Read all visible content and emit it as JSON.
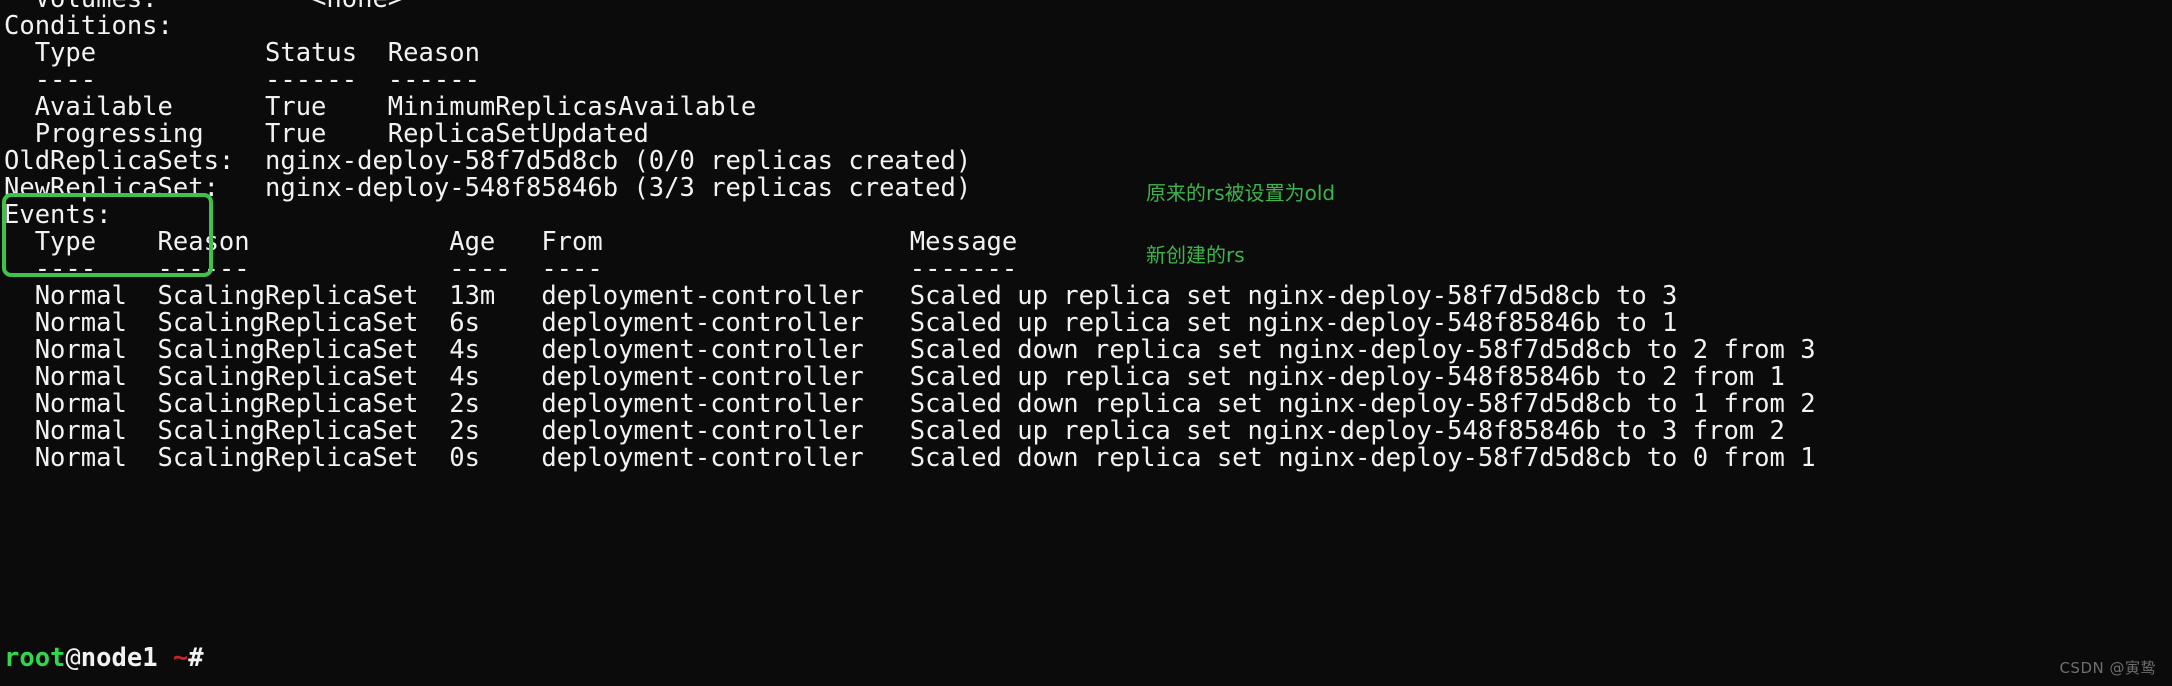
{
  "terminal": {
    "prompt": {
      "user": "root",
      "at": "@",
      "host": "node1",
      "path": "~",
      "symbol": "#"
    },
    "colors": {
      "background": "#0b0b0b",
      "foreground": "#f2f2f2",
      "highlight_green": "#3fc14a",
      "annotation_green": "#3eb44a",
      "prompt_user_green": "#2fd94b",
      "prompt_tilde_red": "#cc2222",
      "watermark_gray": "#6e6e6e"
    },
    "lines": [
      "  Volumes:          <none>",
      "Conditions:",
      "  Type           Status  Reason",
      "  ----           ------  ------",
      "  Available      True    MinimumReplicasAvailable",
      "  Progressing    True    ReplicaSetUpdated",
      "OldReplicaSets:  nginx-deploy-58f7d5d8cb (0/0 replicas created)",
      "NewReplicaSet:   nginx-deploy-548f85846b (3/3 replicas created)",
      "Events:",
      "  Type    Reason             Age   From                    Message",
      "  ----    ------             ----  ----                    -------",
      "  Normal  ScalingReplicaSet  13m   deployment-controller   Scaled up replica set nginx-deploy-58f7d5d8cb to 3",
      "  Normal  ScalingReplicaSet  6s    deployment-controller   Scaled up replica set nginx-deploy-548f85846b to 1",
      "  Normal  ScalingReplicaSet  4s    deployment-controller   Scaled down replica set nginx-deploy-58f7d5d8cb to 2 from 3",
      "  Normal  ScalingReplicaSet  4s    deployment-controller   Scaled up replica set nginx-deploy-548f85846b to 2 from 1",
      "  Normal  ScalingReplicaSet  2s    deployment-controller   Scaled down replica set nginx-deploy-58f7d5d8cb to 1 from 2",
      "  Normal  ScalingReplicaSet  2s    deployment-controller   Scaled up replica set nginx-deploy-548f85846b to 3 from 2",
      "  Normal  ScalingReplicaSet  0s    deployment-controller   Scaled down replica set nginx-deploy-58f7d5d8cb to 0 from 1"
    ],
    "conditions_section": {
      "label": "Conditions:",
      "headers": [
        "Type",
        "Status",
        "Reason"
      ],
      "underlines": [
        "----",
        "------",
        "------"
      ],
      "rows": [
        {
          "type": "Available",
          "status": "True",
          "reason": "MinimumReplicasAvailable"
        },
        {
          "type": "Progressing",
          "status": "True",
          "reason": "ReplicaSetUpdated"
        }
      ]
    },
    "replicasets": {
      "old_label": "OldReplicaSets:",
      "old_value": "nginx-deploy-58f7d5d8cb (0/0 replicas created)",
      "new_label": "NewReplicaSet:",
      "new_value": "nginx-deploy-548f85846b (3/3 replicas created)"
    },
    "events_section": {
      "label": "Events:",
      "headers": [
        "Type",
        "Reason",
        "Age",
        "From",
        "Message"
      ],
      "underlines": [
        "----",
        "------",
        "----",
        "----",
        "-------"
      ],
      "rows": [
        {
          "type": "Normal",
          "reason": "ScalingReplicaSet",
          "age": "13m",
          "from": "deployment-controller",
          "message": "Scaled up replica set nginx-deploy-58f7d5d8cb to 3"
        },
        {
          "type": "Normal",
          "reason": "ScalingReplicaSet",
          "age": "6s",
          "from": "deployment-controller",
          "message": "Scaled up replica set nginx-deploy-548f85846b to 1"
        },
        {
          "type": "Normal",
          "reason": "ScalingReplicaSet",
          "age": "4s",
          "from": "deployment-controller",
          "message": "Scaled down replica set nginx-deploy-58f7d5d8cb to 2 from 3"
        },
        {
          "type": "Normal",
          "reason": "ScalingReplicaSet",
          "age": "4s",
          "from": "deployment-controller",
          "message": "Scaled up replica set nginx-deploy-548f85846b to 2 from 1"
        },
        {
          "type": "Normal",
          "reason": "ScalingReplicaSet",
          "age": "2s",
          "from": "deployment-controller",
          "message": "Scaled down replica set nginx-deploy-58f7d5d8cb to 1 from 2"
        },
        {
          "type": "Normal",
          "reason": "ScalingReplicaSet",
          "age": "2s",
          "from": "deployment-controller",
          "message": "Scaled up replica set nginx-deploy-548f85846b to 3 from 2"
        },
        {
          "type": "Normal",
          "reason": "ScalingReplicaSet",
          "age": "0s",
          "from": "deployment-controller",
          "message": "Scaled down replica set nginx-deploy-58f7d5d8cb to 0 from 1"
        }
      ]
    },
    "annotations": {
      "old_rs_note": "原来的rs被设置为old",
      "new_rs_note": "新创建的rs"
    },
    "watermark": "CSDN @寅鸷"
  }
}
